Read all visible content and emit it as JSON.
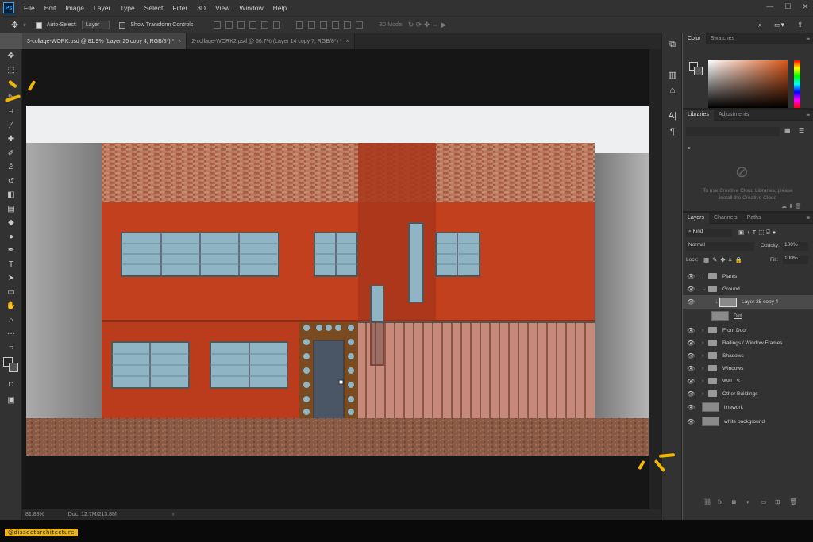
{
  "menubar": {
    "items": [
      "File",
      "Edit",
      "Image",
      "Layer",
      "Type",
      "Select",
      "Filter",
      "3D",
      "View",
      "Window",
      "Help"
    ]
  },
  "options": {
    "auto_select_label": "Auto-Select:",
    "auto_select_value": "Layer",
    "show_transform_label": "Show Transform Controls",
    "mode_3d_label": "3D Mode:"
  },
  "tabs": [
    {
      "label": "3-collage-WORK.psd @ 81.9% (Layer 25 copy 4, RGB/8*) *",
      "close": "×"
    },
    {
      "label": "2-collage-WORK2.psd @ 66.7% (Layer 14 copy 7, RGB/8*) *",
      "close": "×"
    }
  ],
  "status": {
    "zoom": "81.88%",
    "doc": "Doc: 12.7M/213.8M",
    "arrow": "›"
  },
  "color_panel": {
    "tabs": [
      "Color",
      "Swatches"
    ]
  },
  "libraries_panel": {
    "tabs": [
      "Libraries",
      "Adjustments"
    ],
    "message": "To use Creative Cloud Libraries, please install the Creative Cloud"
  },
  "layers_panel": {
    "tabs": [
      "Layers",
      "Channels",
      "Paths"
    ],
    "kind_label": "Kind",
    "blend_mode": "Normal",
    "opacity_label": "Opacity:",
    "opacity_value": "100%",
    "lock_label": "Lock:",
    "fill_label": "Fill:",
    "fill_value": "100%",
    "layers": [
      {
        "name": "Plants",
        "type": "folder"
      },
      {
        "name": "Ground",
        "type": "folder",
        "open": true
      },
      {
        "name": "Layer 25 copy 4",
        "type": "layer",
        "selected": true
      },
      {
        "name": "Dirt",
        "type": "layer"
      },
      {
        "name": "Front Door",
        "type": "folder"
      },
      {
        "name": "Railings / Window Frames",
        "type": "folder"
      },
      {
        "name": "Shadows",
        "type": "folder"
      },
      {
        "name": "Windows",
        "type": "folder"
      },
      {
        "name": "WALLS",
        "type": "folder"
      },
      {
        "name": "Other Buildings",
        "type": "folder"
      },
      {
        "name": "linework",
        "type": "layer"
      },
      {
        "name": "white background",
        "type": "layer"
      }
    ]
  },
  "watermark": "@dissectarchitecture",
  "colors": {
    "orange": "#c2401d",
    "brick": "#b06a4f",
    "glass": "#8fb4c4",
    "ground": "#8a5a45",
    "highlight": "#f2b705"
  }
}
